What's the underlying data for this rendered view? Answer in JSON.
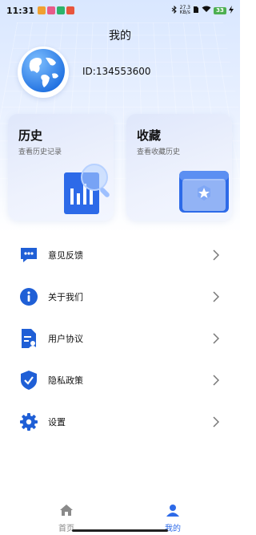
{
  "status_bar": {
    "time": "11:31",
    "speed_value": "27.3",
    "speed_unit": "KB/s",
    "battery": "33"
  },
  "page": {
    "title": "我的"
  },
  "profile": {
    "id_text": "ID:134553600"
  },
  "cards": {
    "history": {
      "title": "历史",
      "subtitle": "查看历史记录"
    },
    "favorites": {
      "title": "收藏",
      "subtitle": "查看收藏历史"
    }
  },
  "menu": {
    "items": [
      {
        "label": "意见反馈",
        "icon": "feedback-chat-icon"
      },
      {
        "label": "关于我们",
        "icon": "info-icon"
      },
      {
        "label": "用户协议",
        "icon": "document-user-icon"
      },
      {
        "label": "隐私政策",
        "icon": "shield-check-icon"
      },
      {
        "label": "设置",
        "icon": "gear-icon"
      }
    ]
  },
  "bottom_nav": {
    "items": [
      {
        "label": "首页",
        "icon": "home-icon",
        "active": false
      },
      {
        "label": "我的",
        "icon": "person-icon",
        "active": true
      }
    ]
  },
  "colors": {
    "accent": "#2d6ae8",
    "icon_blue": "#1f5fd6",
    "inactive": "#888888",
    "battery_green": "#4caf50"
  }
}
